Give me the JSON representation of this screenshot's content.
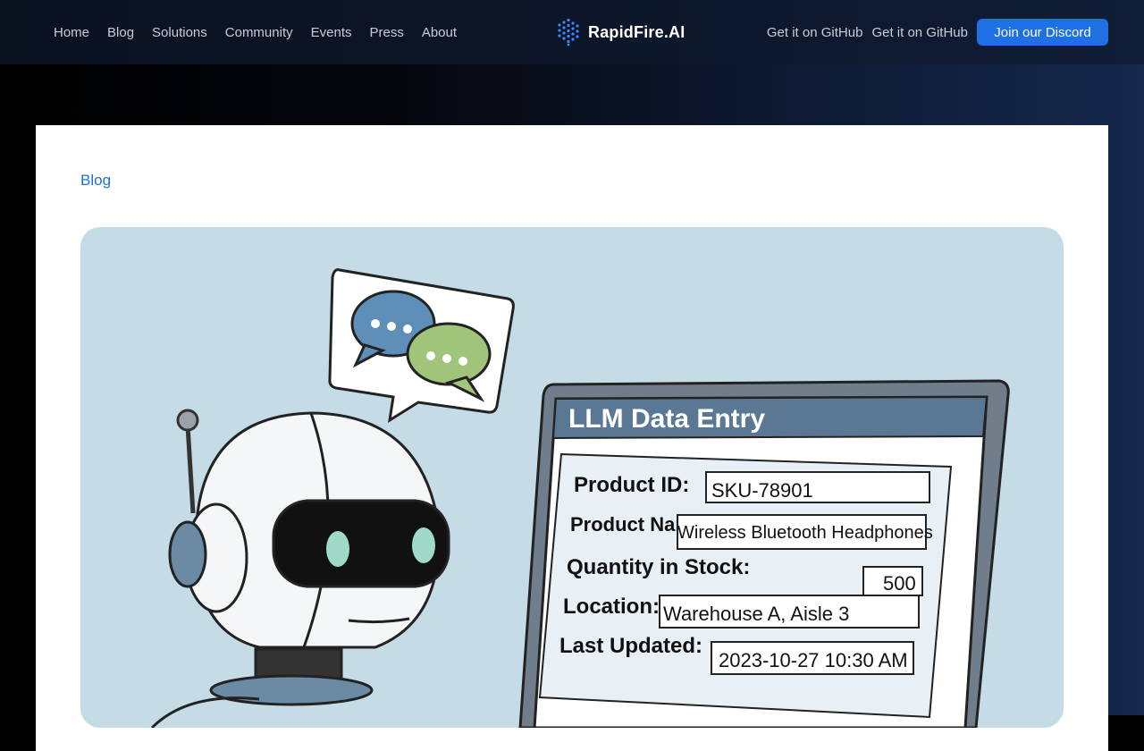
{
  "nav": {
    "links": [
      "Home",
      "Blog",
      "Solutions",
      "Community",
      "Events",
      "Press",
      "About"
    ],
    "logo_text": "RapidFire.AI",
    "github_links": [
      "Get it on GitHub",
      "Get it on GitHub"
    ],
    "discord_button": "Join our Discord"
  },
  "colors": {
    "accent": "#1f6fe5",
    "link": "#1f6fd0",
    "nav_bg": "#0d1628"
  },
  "breadcrumb": "Blog",
  "illustration": {
    "window_title": "LLM Data Entry",
    "fields": [
      {
        "label": "Product ID:",
        "value": "SKU-78901"
      },
      {
        "label": "Product Name:",
        "value": "Wireless Bluetooth Headphones"
      },
      {
        "label": "Quantity in Stock:",
        "value": "500"
      },
      {
        "label": "Location:",
        "value": "Warehouse A, Aisle 3"
      },
      {
        "label": "Last Updated:",
        "value": "2023-10-27 10:30 AM"
      }
    ]
  }
}
